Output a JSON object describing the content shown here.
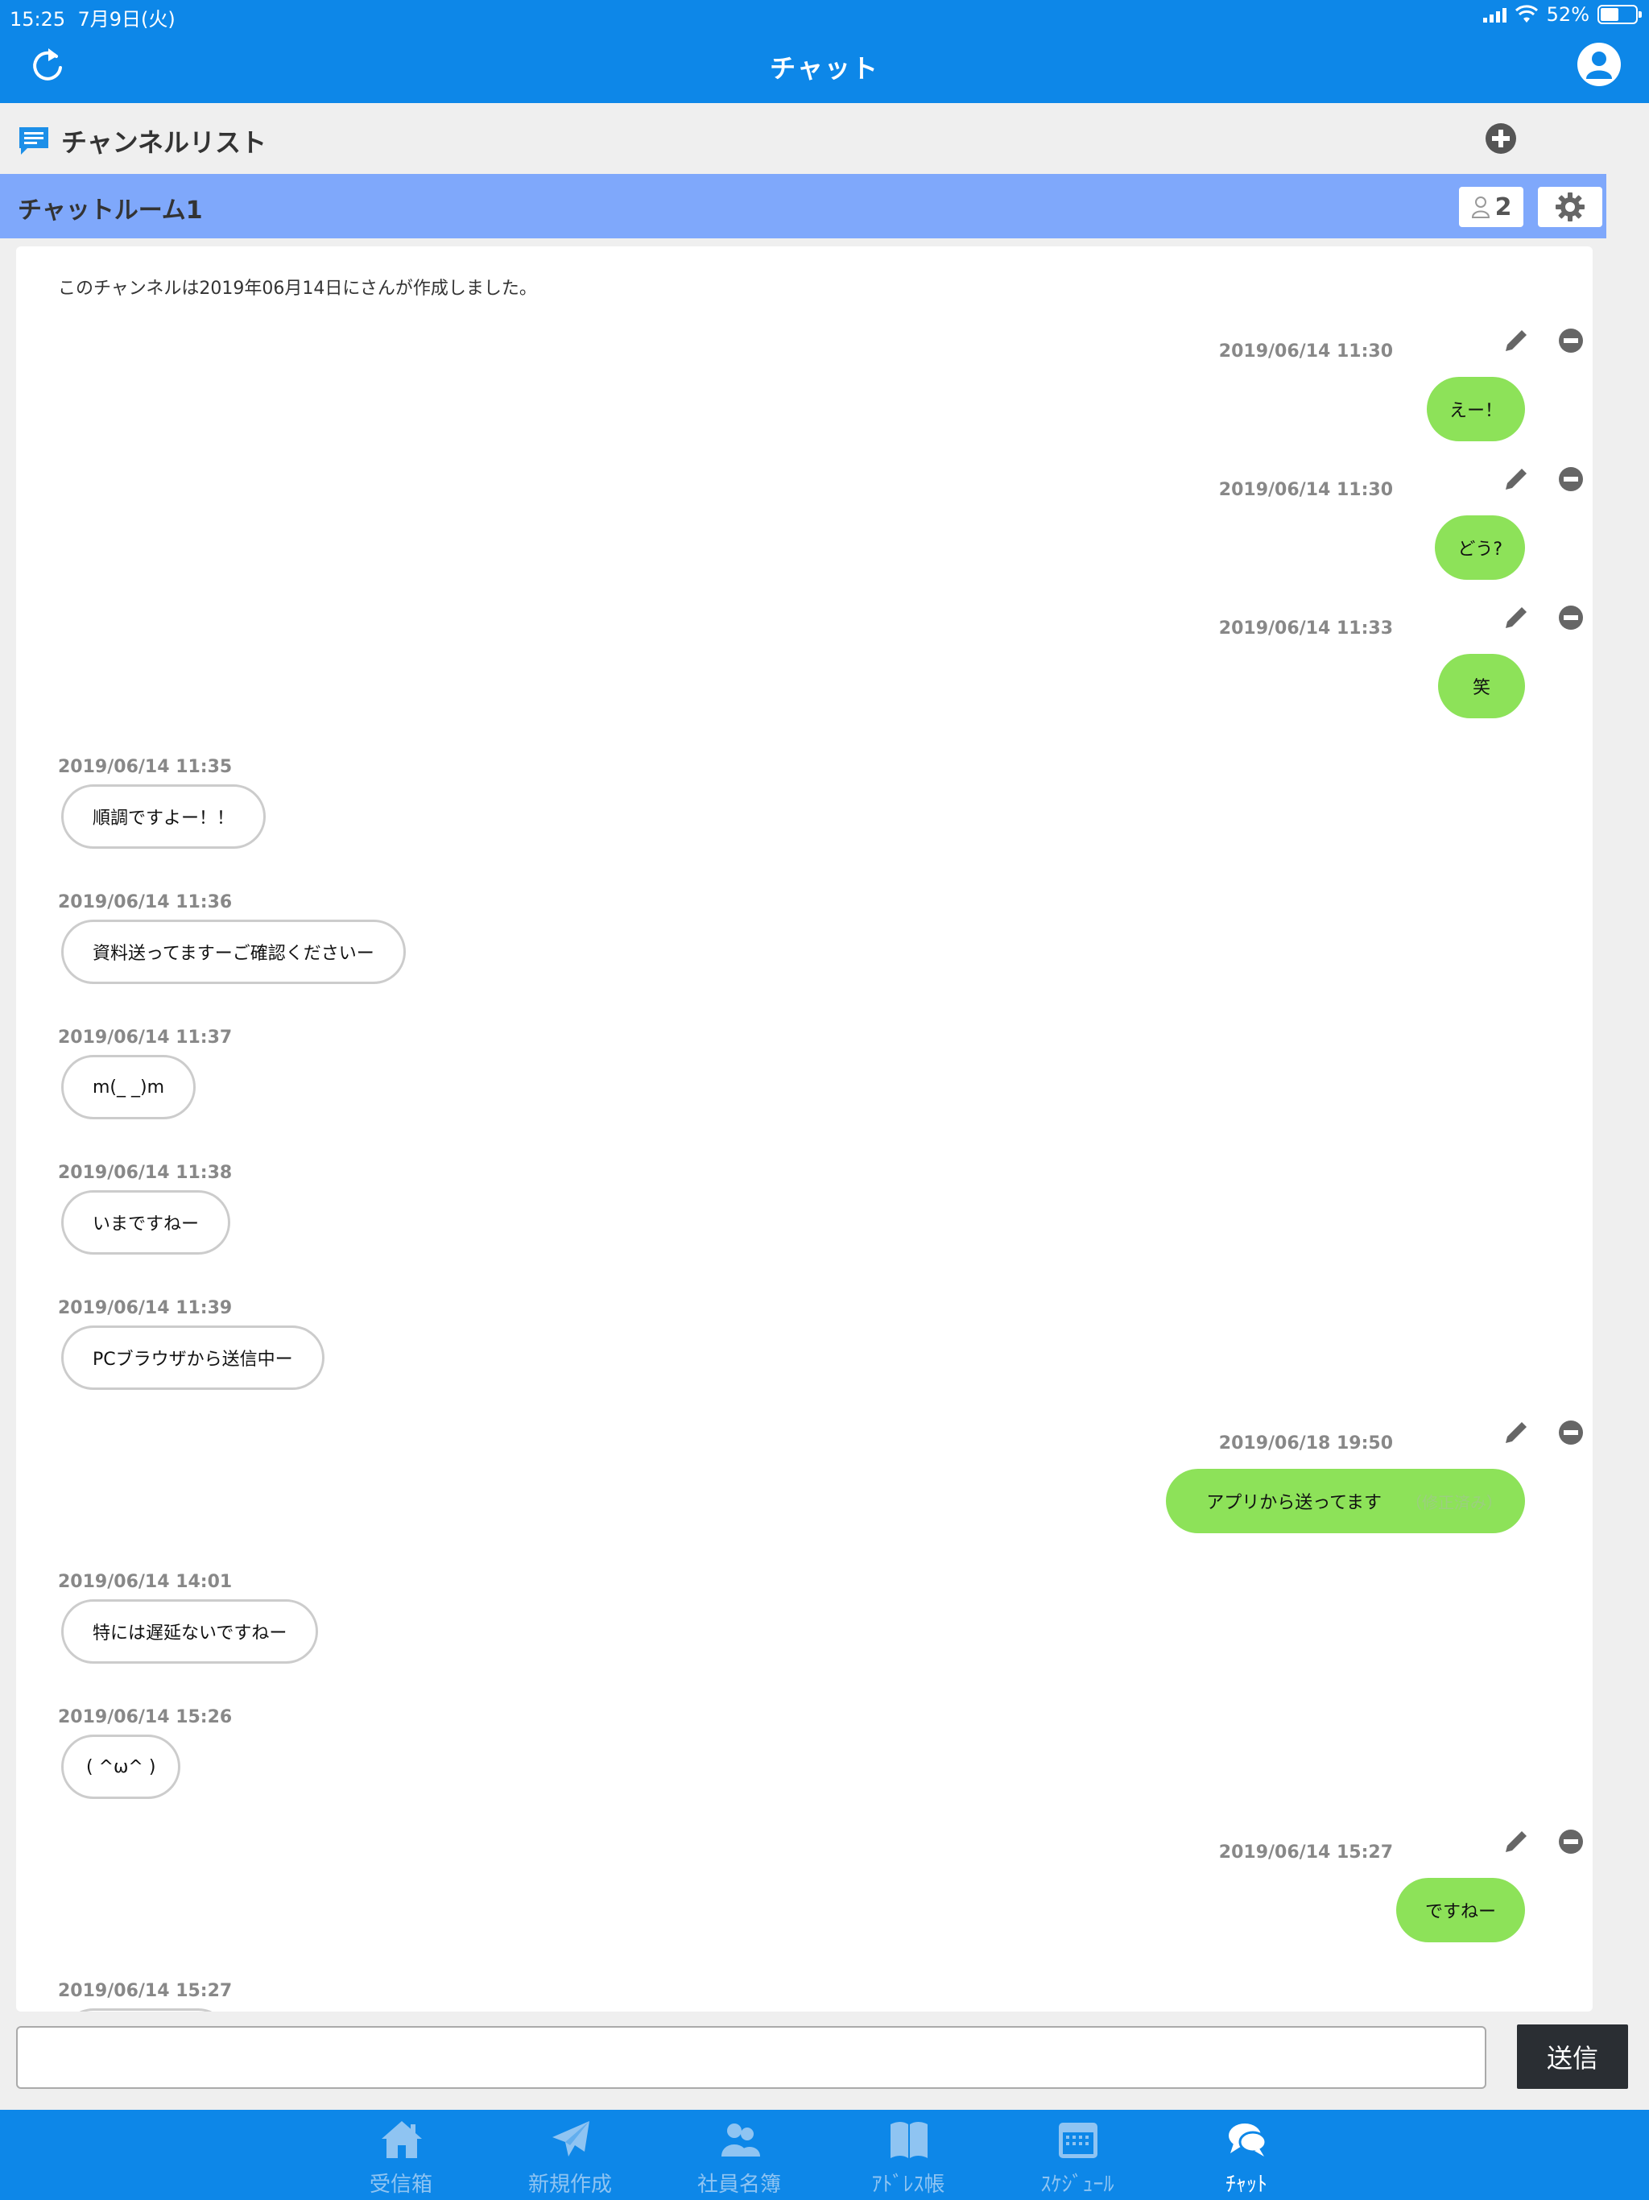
{
  "status_bar": {
    "time": "15:25",
    "date": "7月9日(火)",
    "battery": "52%"
  },
  "header": {
    "title": "チャット"
  },
  "channel_list": {
    "title": "チャンネルリスト"
  },
  "room": {
    "name": "チャットルーム1",
    "member_count": "2"
  },
  "notice": "このチャンネルは2019年06月14日にさんが作成しました。",
  "messages": [
    {
      "time": "2019/06/14 11:30",
      "text": "えー！"
    },
    {
      "time": "2019/06/14 11:30",
      "text": "どう?"
    },
    {
      "time": "2019/06/14 11:33",
      "text": "笑"
    },
    {
      "time": "2019/06/14 11:35",
      "text": "順調ですよー！！"
    },
    {
      "time": "2019/06/14 11:36",
      "text": "資料送ってますーご確認くださいー"
    },
    {
      "time": "2019/06/14 11:37",
      "text": "m(_ _)m"
    },
    {
      "time": "2019/06/14 11:38",
      "text": "いまですねー"
    },
    {
      "time": "2019/06/14 11:39",
      "text": "PCブラウザから送信中ー"
    },
    {
      "time": "2019/06/18 19:50",
      "text": "アプリから送ってます",
      "edited": "（修正済み）"
    },
    {
      "time": "2019/06/14 14:01",
      "text": "特には遅延ないですねー"
    },
    {
      "time": "2019/06/14 15:26",
      "text": "( ^ω^ )"
    },
    {
      "time": "2019/06/14 15:27",
      "text": "ですねー"
    },
    {
      "time": "2019/06/14 15:27",
      "text": ""
    }
  ],
  "composer": {
    "value": "",
    "placeholder": "",
    "send_label": "送信"
  },
  "tabs": [
    {
      "label": "受信箱"
    },
    {
      "label": "新規作成"
    },
    {
      "label": "社員名簿"
    },
    {
      "label": "ｱﾄﾞﾚｽ帳"
    },
    {
      "label": "ｽｹｼﾞｭｰﾙ"
    },
    {
      "label": "ﾁｬｯﾄ"
    }
  ],
  "colors": {
    "header": "#0d87e8",
    "room_bar": "#7fa8fb",
    "my_bubble": "#8de259",
    "send_button": "#2a2e33"
  }
}
